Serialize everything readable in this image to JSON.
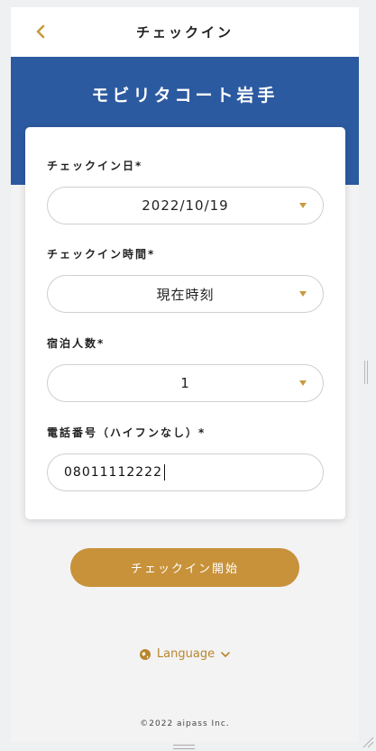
{
  "header": {
    "title": "チェックイン",
    "back_icon": "chevron-left-icon"
  },
  "banner": {
    "title": "モビリタコート岩手"
  },
  "form": {
    "checkin_date": {
      "label": "チェックイン日*",
      "value": "2022/10/19"
    },
    "checkin_time": {
      "label": "チェックイン時間*",
      "value": "現在時刻"
    },
    "guests": {
      "label": "宿泊人数*",
      "value": "1"
    },
    "phone": {
      "label": "電話番号（ハイフンなし）*",
      "value": "08011112222"
    }
  },
  "actions": {
    "start_label": "チェックイン開始"
  },
  "language": {
    "label": "Language",
    "icon": "globe-icon"
  },
  "footer": {
    "copyright": "©2022 aipass Inc."
  },
  "colors": {
    "accent": "#c8923a",
    "banner": "#2c5aa0",
    "background": "#f3f3f4"
  }
}
